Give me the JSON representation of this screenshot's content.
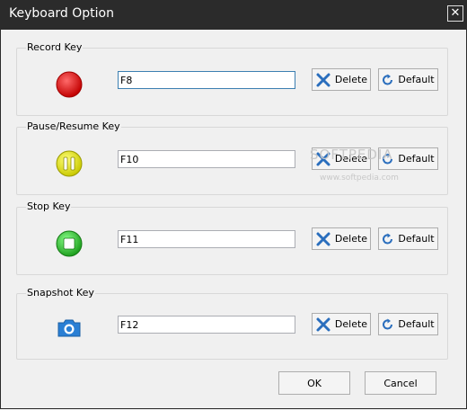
{
  "window": {
    "title": "Keyboard Option",
    "close_glyph": "✕"
  },
  "groups": [
    {
      "label": "Record Key",
      "key": "F8",
      "icon": "record-icon"
    },
    {
      "label": "Pause/Resume Key",
      "key": "F10",
      "icon": "pause-icon"
    },
    {
      "label": "Stop Key",
      "key": "F11",
      "icon": "stop-icon"
    },
    {
      "label": "Snapshot Key",
      "key": "F12",
      "icon": "camera-icon"
    }
  ],
  "buttons": {
    "delete": "Delete",
    "default": "Default",
    "ok": "OK",
    "cancel": "Cancel"
  },
  "watermark": {
    "line1": "SOFTPEDIA",
    "line2": "www.softpedia.com"
  },
  "colors": {
    "record": "#e01010",
    "pause": "#e6e600",
    "stop": "#33cc33",
    "camera": "#2a7fd4"
  }
}
